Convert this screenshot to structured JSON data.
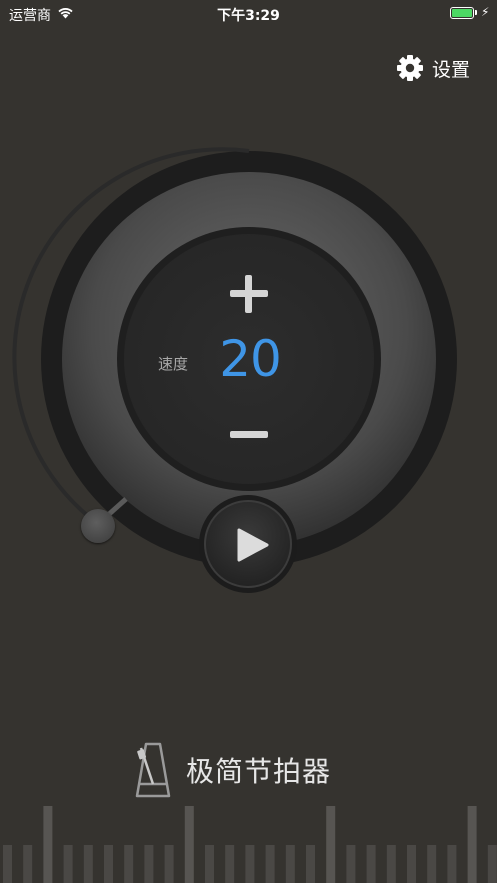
{
  "status_bar": {
    "carrier": "运营商",
    "time": "下午3:29",
    "battery_percent": 100,
    "battery_color": "#4cd964"
  },
  "header": {
    "settings_label": "设置",
    "settings_icon": "gear-icon"
  },
  "metronome": {
    "tempo_label": "速度",
    "tempo_value": "20",
    "tempo_color": "#3f95e6",
    "increase_icon": "plus-icon",
    "decrease_icon": "minus-icon",
    "play_icon": "play-icon"
  },
  "brand": {
    "app_name": "极简节拍器",
    "logo_icon": "metronome-icon"
  },
  "colors": {
    "background": "#35332f",
    "accent": "#3f95e6"
  }
}
